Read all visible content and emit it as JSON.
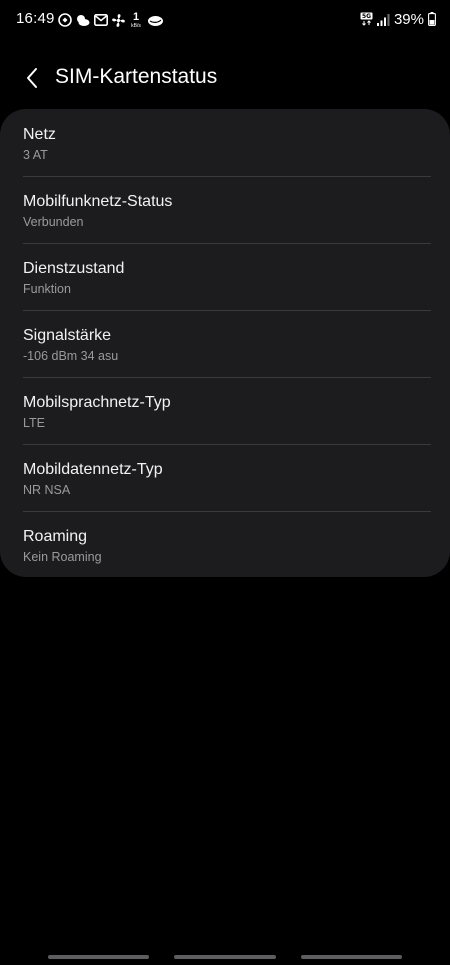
{
  "status_bar": {
    "time": "16:49",
    "network_speed_value": "1",
    "network_speed_unit": "kB/s",
    "battery_percent": "39%",
    "icons": [
      "app-notification-icon",
      "weather-icon",
      "mail-icon",
      "fan-icon",
      "net-speed-icon",
      "cloud-icon",
      "5g-icon",
      "signal-icon",
      "battery-icon"
    ]
  },
  "header": {
    "title": "SIM-Kartenstatus"
  },
  "rows": [
    {
      "title": "Netz",
      "value": "3 AT"
    },
    {
      "title": "Mobilfunknetz-Status",
      "value": "Verbunden"
    },
    {
      "title": "Dienstzustand",
      "value": "Funktion"
    },
    {
      "title": "Signalstärke",
      "value": "-106 dBm 34 asu"
    },
    {
      "title": "Mobilsprachnetz-Typ",
      "value": "LTE"
    },
    {
      "title": "Mobildatennetz-Typ",
      "value": "NR NSA"
    },
    {
      "title": "Roaming",
      "value": "Kein Roaming"
    }
  ],
  "colors": {
    "background": "#000000",
    "card": "#1c1c1e",
    "title_text": "#f2f2f2",
    "subtitle_text": "#9a9a9a",
    "divider": "#3a3a3c"
  }
}
